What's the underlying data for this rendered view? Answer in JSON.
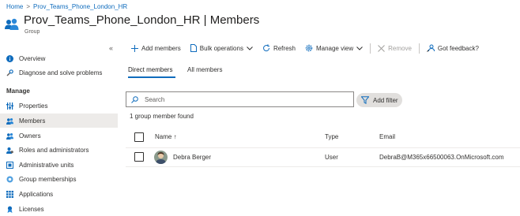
{
  "breadcrumb": {
    "home": "Home",
    "separator": ">",
    "group": "Prov_Teams_Phone_London_HR"
  },
  "header": {
    "title": "Prov_Teams_Phone_London_HR | Members",
    "subtitle": "Group",
    "more": "···",
    "icon": "group-icon"
  },
  "sidebar": {
    "collapse_glyph": "«",
    "top_items": [
      {
        "label": "Overview",
        "icon": "info-icon"
      },
      {
        "label": "Diagnose and solve problems",
        "icon": "wrench-icon"
      }
    ],
    "section_label": "Manage",
    "manage_items": [
      {
        "label": "Properties",
        "icon": "properties-icon"
      },
      {
        "label": "Members",
        "icon": "members-icon",
        "selected": true
      },
      {
        "label": "Owners",
        "icon": "owners-icon"
      },
      {
        "label": "Roles and administrators",
        "icon": "roles-icon"
      },
      {
        "label": "Administrative units",
        "icon": "admin-units-icon"
      },
      {
        "label": "Group memberships",
        "icon": "group-memberships-icon"
      },
      {
        "label": "Applications",
        "icon": "applications-icon"
      },
      {
        "label": "Licenses",
        "icon": "licenses-icon"
      }
    ]
  },
  "toolbar": {
    "add_members": "Add members",
    "bulk_operations": "Bulk operations",
    "refresh": "Refresh",
    "manage_view": "Manage view",
    "remove": "Remove",
    "feedback": "Got feedback?"
  },
  "tabs": {
    "direct": "Direct members",
    "all": "All members",
    "active": "direct"
  },
  "search": {
    "placeholder": "Search",
    "value": ""
  },
  "filter": {
    "label": "Add filter"
  },
  "results": {
    "count_text": "1 group member found"
  },
  "table": {
    "columns": {
      "name": "Name ↑",
      "type": "Type",
      "email": "Email"
    },
    "rows": [
      {
        "name": "Debra Berger",
        "type": "User",
        "email": "DebraB@M365x66500063.OnMicrosoft.com",
        "checked": false
      }
    ]
  },
  "colors": {
    "accent": "#0f6cbd",
    "selected_bg": "#edebe9"
  }
}
